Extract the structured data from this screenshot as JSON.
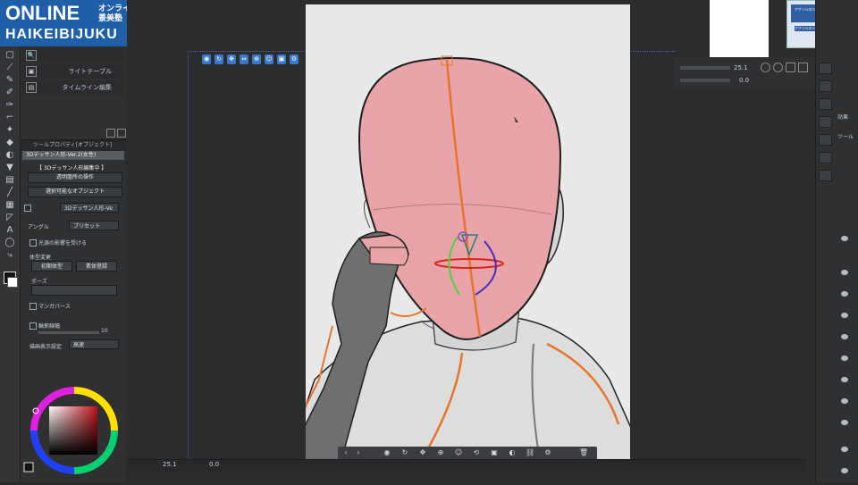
{
  "logo": {
    "line1": "ONLINE",
    "line1_side": "オンライン 背景美塾",
    "line2": "HAIKEIBIJUKU"
  },
  "subpanel": {
    "items": [
      {
        "label": "ライトテーブル"
      },
      {
        "label": "タイムライン編集"
      }
    ]
  },
  "tool_property": {
    "header": "ツールプロパティ[オブジェクト]",
    "selected_item": "3Dデッサン人形-Ver.2(女性)",
    "mode_banner": "【 3Dデッサン人形編集中 】",
    "drop_transparent": "透明箇所の操作",
    "drop_selectable": "選択可能なオブジェクト",
    "layer_name": "3Dデッサン人形-Ve",
    "angle_label": "アングル",
    "preset_label": "プリセット",
    "light_label": "光源の影響を受ける",
    "body_shape_label": "体型変更",
    "body_btn1": "初期体型",
    "body_btn2": "素体登録",
    "pose_label": "ポーズ",
    "manga_label": "マンガパース",
    "outline_label": "輪郭線幅",
    "outline_value": "10",
    "render_label": "描画表示設定",
    "render_value": "高速"
  },
  "bottom": {
    "zoom": "25.1",
    "angle": "0.0"
  },
  "navigator": {
    "zoom": "25.1",
    "angle": "0.0"
  },
  "thumb": {
    "line1": "アクリルのツール描画講座",
    "line2": "アクリルのツール描画講座"
  },
  "right_panel": {
    "label1": "効果",
    "label2": "ツール"
  },
  "colors": {
    "accent": "#1f5fa8",
    "head": "#e8a4a8",
    "orange": "#e8742c"
  },
  "icons": [
    "selection-icon",
    "pen-icon",
    "brush-icon",
    "eraser-icon",
    "fill-icon",
    "text-icon",
    "gradient-icon",
    "figure-icon",
    "move-icon"
  ]
}
